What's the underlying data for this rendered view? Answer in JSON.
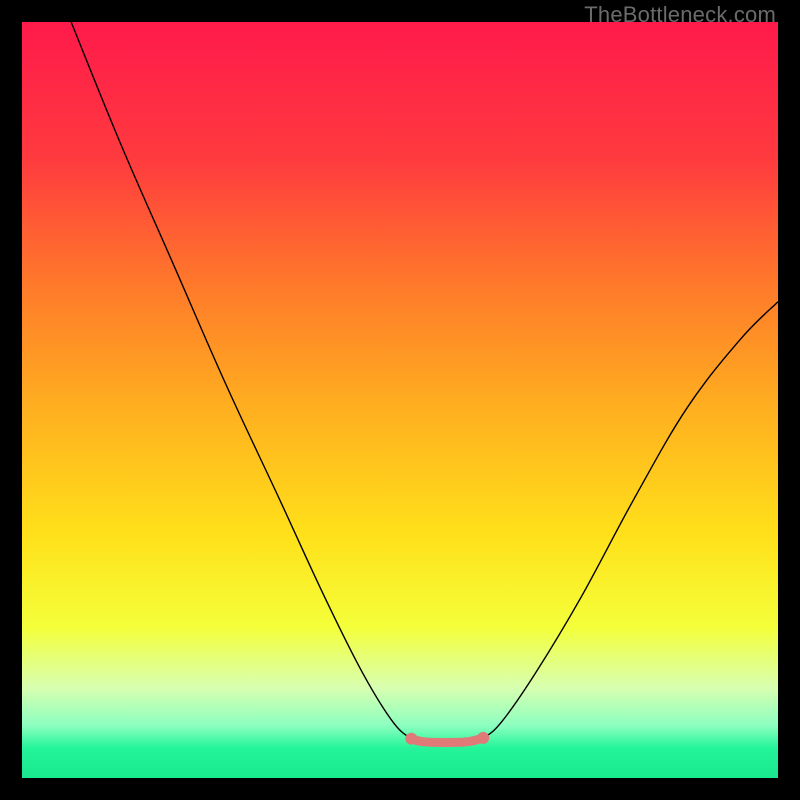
{
  "watermark": "TheBottleneck.com",
  "chart_data": {
    "type": "line",
    "title": "",
    "xlabel": "",
    "ylabel": "",
    "xlim": [
      0,
      100
    ],
    "ylim": [
      0,
      100
    ],
    "gradient_stops": [
      {
        "offset": 0,
        "color": "#ff1a4b"
      },
      {
        "offset": 18,
        "color": "#ff3a3f"
      },
      {
        "offset": 35,
        "color": "#ff7a2a"
      },
      {
        "offset": 52,
        "color": "#ffb21f"
      },
      {
        "offset": 68,
        "color": "#ffe11a"
      },
      {
        "offset": 80,
        "color": "#f4ff3a"
      },
      {
        "offset": 88,
        "color": "#d8ffb0"
      },
      {
        "offset": 93,
        "color": "#8effc0"
      },
      {
        "offset": 96,
        "color": "#25f59a"
      },
      {
        "offset": 100,
        "color": "#19e98e"
      }
    ],
    "series": [
      {
        "name": "bottleneck-curve",
        "stroke": "#000000",
        "stroke_width": 1.4,
        "points": [
          {
            "x": 6.5,
            "y": 100
          },
          {
            "x": 13,
            "y": 84
          },
          {
            "x": 20,
            "y": 68
          },
          {
            "x": 27,
            "y": 52
          },
          {
            "x": 34,
            "y": 37
          },
          {
            "x": 40,
            "y": 24
          },
          {
            "x": 45,
            "y": 14
          },
          {
            "x": 49,
            "y": 7.5
          },
          {
            "x": 51.5,
            "y": 5.2
          },
          {
            "x": 53,
            "y": 4.8
          },
          {
            "x": 56,
            "y": 4.7
          },
          {
            "x": 59,
            "y": 4.8
          },
          {
            "x": 61,
            "y": 5.3
          },
          {
            "x": 63.5,
            "y": 7.5
          },
          {
            "x": 68,
            "y": 14
          },
          {
            "x": 74,
            "y": 24
          },
          {
            "x": 81,
            "y": 37
          },
          {
            "x": 88,
            "y": 49
          },
          {
            "x": 95,
            "y": 58
          },
          {
            "x": 100,
            "y": 63
          }
        ]
      },
      {
        "name": "optimal-segment",
        "stroke": "#e07a78",
        "stroke_width": 9,
        "linecap": "round",
        "points": [
          {
            "x": 51.5,
            "y": 5.2
          },
          {
            "x": 53,
            "y": 4.8
          },
          {
            "x": 56,
            "y": 4.7
          },
          {
            "x": 59,
            "y": 4.8
          },
          {
            "x": 61,
            "y": 5.3
          }
        ],
        "endpoint_markers": [
          {
            "x": 51.5,
            "y": 5.2,
            "r": 6
          },
          {
            "x": 61,
            "y": 5.3,
            "r": 6
          }
        ]
      }
    ]
  }
}
